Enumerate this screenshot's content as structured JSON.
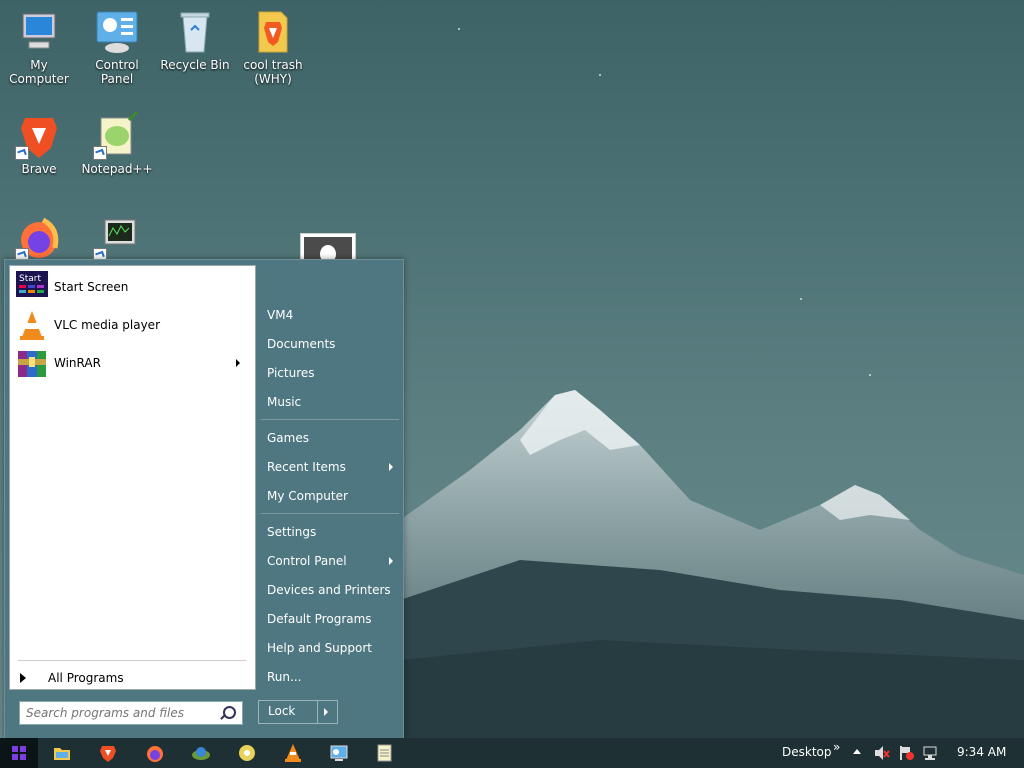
{
  "desktop": {
    "icons": [
      {
        "label": "My Computer"
      },
      {
        "label": "Control Panel"
      },
      {
        "label": "Recycle Bin"
      },
      {
        "label": "cool trash (WHY)"
      },
      {
        "label": "Brave"
      },
      {
        "label": "Notepad++"
      },
      {
        "label": "Firefox"
      },
      {
        "label": "Task Manager"
      }
    ]
  },
  "start_menu": {
    "programs": [
      {
        "label": "Start Screen",
        "icon": "start-screen-icon"
      },
      {
        "label": "VLC media player",
        "icon": "vlc-icon"
      },
      {
        "label": "WinRAR",
        "icon": "winrar-icon",
        "has_submenu": true
      }
    ],
    "all_programs": "All Programs",
    "search_placeholder": "Search programs and files",
    "right_items": [
      {
        "label": "VM4"
      },
      {
        "label": "Documents"
      },
      {
        "label": "Pictures"
      },
      {
        "label": "Music"
      },
      {
        "label": "Games"
      },
      {
        "label": "Recent Items",
        "has_submenu": true
      },
      {
        "label": "My Computer"
      },
      {
        "label": "Settings"
      },
      {
        "label": "Control Panel",
        "has_submenu": true
      },
      {
        "label": "Devices and Printers"
      },
      {
        "label": "Default Programs"
      },
      {
        "label": "Help and Support"
      },
      {
        "label": "Run..."
      }
    ],
    "lock_label": "Lock"
  },
  "taskbar": {
    "pinned": [
      "file-explorer-icon",
      "brave-icon",
      "firefox-icon",
      "network-icon",
      "media-icon",
      "vlc-icon",
      "control-panel-icon",
      "notepad-icon"
    ],
    "desktop_label": "Desktop",
    "chevrons": "»",
    "time": "9:34 AM"
  },
  "colors": {
    "accent": "#7b3fe0",
    "menu_bg": "#4e7781",
    "taskbar_bg": "#1e3033"
  }
}
